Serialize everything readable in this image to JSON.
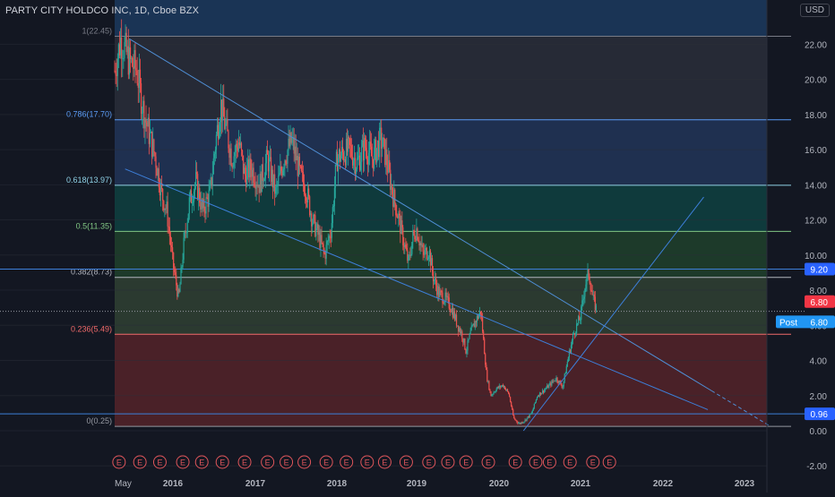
{
  "header": {
    "symbol": "PARTY CITY HOLDCO INC",
    "interval": "1D",
    "exchange": "Cboe BZX",
    "currency": "USD"
  },
  "price_labels": {
    "last": "6.80",
    "post_tag": "Post",
    "post_value": "6.80",
    "resistance": "9.20",
    "support": "0.96"
  },
  "chart_data": {
    "type": "candlestick",
    "x_tick_labels": [
      "May",
      "2016",
      "2017",
      "2018",
      "2019",
      "2020",
      "2021",
      "2022",
      "2023"
    ],
    "y_tick_labels": [
      "-2.00",
      "0.00",
      "2.00",
      "4.00",
      "6.00",
      "8.00",
      "10.00",
      "12.00",
      "14.00",
      "16.00",
      "18.00",
      "20.00",
      "22.00"
    ],
    "ylim": [
      -2.5,
      24
    ],
    "x_range": [
      2015.33,
      2023.5
    ],
    "fib_levels": [
      {
        "label": "1(22.45)",
        "value": 22.45,
        "color": "#787b86",
        "fill": "#1e3a5f"
      },
      {
        "label": "0.786(17.70)",
        "value": 17.7,
        "color": "#5b9cf6",
        "fill": "#1e2f4a"
      },
      {
        "label": "0.618(13.97)",
        "value": 13.97,
        "color": "#8fd1e6",
        "fill": "#133b3f"
      },
      {
        "label": "0.5(11.35)",
        "value": 11.35,
        "color": "#81c784",
        "fill": "#1c3d2c"
      },
      {
        "label": "0.382(8.73)",
        "value": 8.73,
        "color": "#b2b5be",
        "fill": "#2a3b2e"
      },
      {
        "label": "0.236(5.49)",
        "value": 5.49,
        "color": "#f06a6a",
        "fill": "#2c3a32"
      },
      {
        "label": "0(0.25)",
        "value": 0.25,
        "color": "#9598a1",
        "fill": "#4a2128"
      }
    ],
    "horizontal_lines": [
      {
        "value": 9.2,
        "label": "9.20"
      },
      {
        "value": 0.96,
        "label": "0.96"
      },
      {
        "value": 6.8,
        "label": "6.80",
        "style": "dotted"
      }
    ],
    "trendlines": [
      {
        "from": [
          2015.5,
          22.3
        ],
        "to": [
          2023.3,
          0.3
        ],
        "dashed_after": 2022.6
      },
      {
        "from": [
          2015.45,
          14.9
        ],
        "to": [
          2022.55,
          1.2
        ]
      },
      {
        "from": [
          2020.3,
          0.0
        ],
        "to": [
          2022.5,
          13.3
        ]
      }
    ],
    "price_path": [
      [
        2015.33,
        20.5
      ],
      [
        2015.4,
        22.3
      ],
      [
        2015.5,
        21.0
      ],
      [
        2015.58,
        20.6
      ],
      [
        2015.65,
        18.5
      ],
      [
        2015.72,
        17.0
      ],
      [
        2015.8,
        15.5
      ],
      [
        2015.87,
        13.5
      ],
      [
        2015.93,
        12.5
      ],
      [
        2016.0,
        9.5
      ],
      [
        2016.07,
        7.5
      ],
      [
        2016.13,
        10.5
      ],
      [
        2016.2,
        13.0
      ],
      [
        2016.28,
        14.2
      ],
      [
        2016.36,
        12.5
      ],
      [
        2016.45,
        13.5
      ],
      [
        2016.52,
        16.5
      ],
      [
        2016.58,
        18.6
      ],
      [
        2016.65,
        17.0
      ],
      [
        2016.72,
        15.5
      ],
      [
        2016.8,
        16.5
      ],
      [
        2016.87,
        14.5
      ],
      [
        2016.95,
        15.0
      ],
      [
        2017.05,
        14.0
      ],
      [
        2017.15,
        15.5
      ],
      [
        2017.25,
        13.5
      ],
      [
        2017.35,
        15.5
      ],
      [
        2017.45,
        16.5
      ],
      [
        2017.55,
        14.5
      ],
      [
        2017.62,
        13.8
      ],
      [
        2017.7,
        12.0
      ],
      [
        2017.78,
        11.0
      ],
      [
        2017.85,
        10.0
      ],
      [
        2017.93,
        11.5
      ],
      [
        2018.0,
        15.5
      ],
      [
        2018.08,
        15.8
      ],
      [
        2018.17,
        16.0
      ],
      [
        2018.25,
        15.2
      ],
      [
        2018.35,
        16.2
      ],
      [
        2018.45,
        15.5
      ],
      [
        2018.55,
        16.6
      ],
      [
        2018.62,
        15.5
      ],
      [
        2018.7,
        13.5
      ],
      [
        2018.78,
        12.0
      ],
      [
        2018.85,
        10.5
      ],
      [
        2018.9,
        9.5
      ],
      [
        2018.95,
        11.0
      ],
      [
        2019.0,
        11.5
      ],
      [
        2019.08,
        10.0
      ],
      [
        2019.15,
        10.3
      ],
      [
        2019.2,
        8.8
      ],
      [
        2019.27,
        7.8
      ],
      [
        2019.35,
        7.5
      ],
      [
        2019.42,
        7.0
      ],
      [
        2019.5,
        6.0
      ],
      [
        2019.55,
        5.5
      ],
      [
        2019.6,
        4.5
      ],
      [
        2019.65,
        5.5
      ],
      [
        2019.72,
        6.3
      ],
      [
        2019.78,
        6.8
      ],
      [
        2019.85,
        3.1
      ],
      [
        2019.9,
        2.0
      ],
      [
        2019.97,
        2.4
      ],
      [
        2020.05,
        2.6
      ],
      [
        2020.12,
        2.1
      ],
      [
        2020.18,
        0.7
      ],
      [
        2020.25,
        0.4
      ],
      [
        2020.32,
        0.6
      ],
      [
        2020.4,
        1.0
      ],
      [
        2020.47,
        2.0
      ],
      [
        2020.55,
        2.3
      ],
      [
        2020.62,
        2.6
      ],
      [
        2020.7,
        3.0
      ],
      [
        2020.78,
        2.5
      ],
      [
        2020.85,
        4.2
      ],
      [
        2020.92,
        5.6
      ],
      [
        2021.0,
        6.5
      ],
      [
        2021.05,
        8.2
      ],
      [
        2021.1,
        9.0
      ],
      [
        2021.15,
        7.5
      ],
      [
        2021.2,
        6.8
      ]
    ],
    "earnings_markers": {
      "glyph": "E",
      "x": [
        2015.38,
        2015.62,
        2015.85,
        2016.12,
        2016.35,
        2016.6,
        2016.87,
        2017.15,
        2017.38,
        2017.6,
        2017.87,
        2018.12,
        2018.38,
        2018.6,
        2018.87,
        2019.15,
        2019.38,
        2019.6,
        2019.87,
        2020.2,
        2020.45,
        2020.62,
        2020.87,
        2021.15,
        2021.35
      ]
    }
  }
}
